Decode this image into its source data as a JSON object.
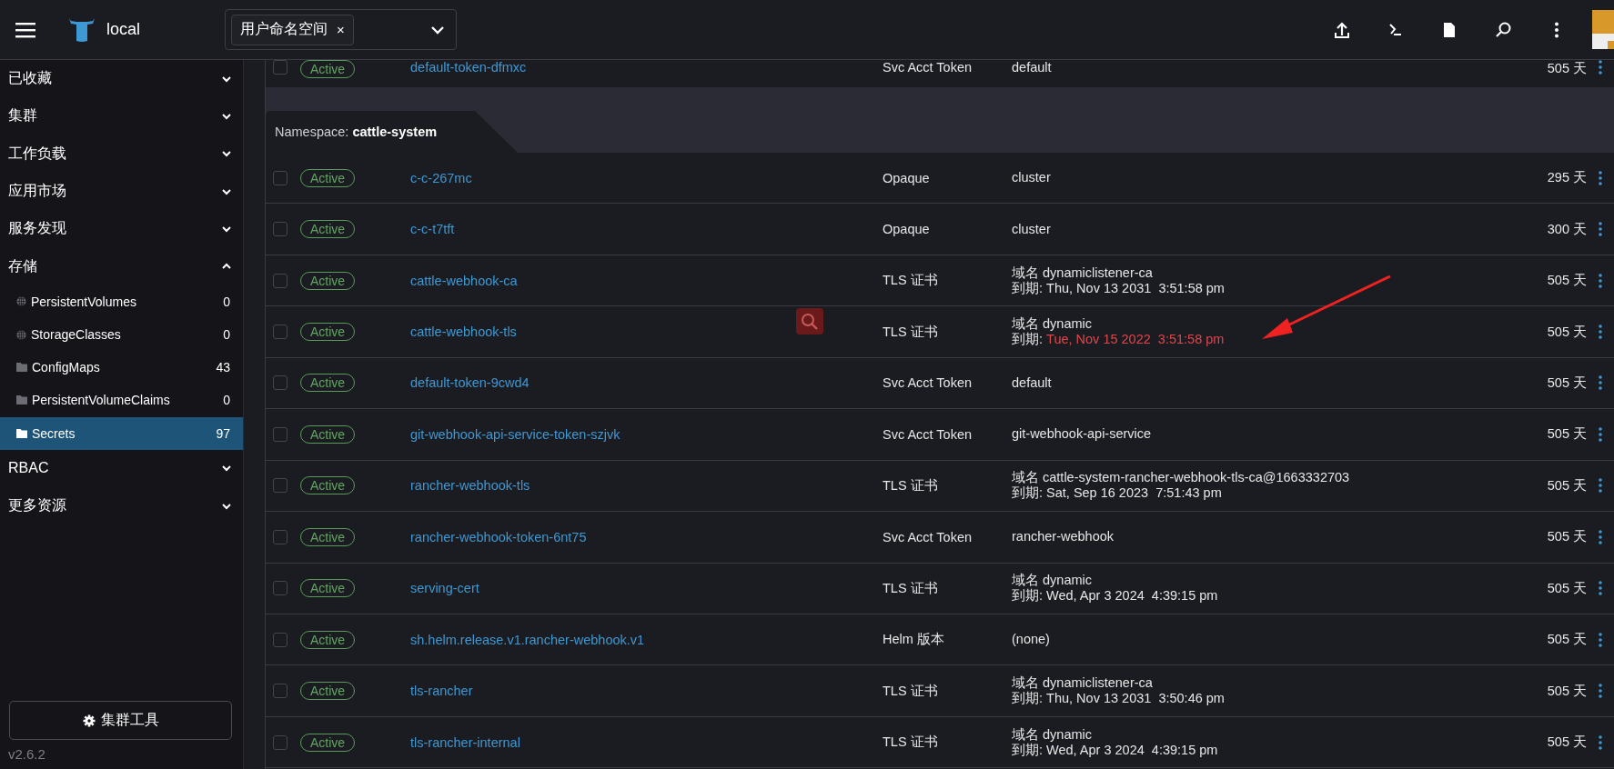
{
  "header": {
    "cluster": "local",
    "namespace_chip": "用户命名空间",
    "chip_remove": "×"
  },
  "sidebar": {
    "groups": [
      {
        "label": "已收藏",
        "expanded": false
      },
      {
        "label": "集群",
        "expanded": false
      },
      {
        "label": "工作负载",
        "expanded": false
      },
      {
        "label": "应用市场",
        "expanded": false
      },
      {
        "label": "服务发现",
        "expanded": false
      },
      {
        "label": "存储",
        "expanded": true,
        "children": [
          {
            "label": "PersistentVolumes",
            "count": "0",
            "kind": "globe",
            "selected": false
          },
          {
            "label": "StorageClasses",
            "count": "0",
            "kind": "globe",
            "selected": false
          },
          {
            "label": "ConfigMaps",
            "count": "43",
            "kind": "folder",
            "selected": false
          },
          {
            "label": "PersistentVolumeClaims",
            "count": "0",
            "kind": "folder",
            "selected": false
          },
          {
            "label": "Secrets",
            "count": "97",
            "kind": "folder",
            "selected": true
          }
        ]
      },
      {
        "label": "RBAC",
        "expanded": false
      },
      {
        "label": "更多资源",
        "expanded": false
      }
    ],
    "tools_button": "集群工具",
    "version": "v2.6.2"
  },
  "table": {
    "items": [
      {
        "kind": "row",
        "checked": false,
        "state": "Active",
        "name": "default-token-dfmxc",
        "type": "Svc Acct Token",
        "data": {
          "kind": "text",
          "text": "default"
        },
        "age": "505 天"
      },
      {
        "kind": "group",
        "label": "Namespace:",
        "value": "cattle-system"
      },
      {
        "kind": "row",
        "checked": false,
        "state": "Active",
        "name": "c-c-267mc",
        "type": "Opaque",
        "data": {
          "kind": "text",
          "text": "cluster"
        },
        "age": "295 天"
      },
      {
        "kind": "row",
        "checked": false,
        "state": "Active",
        "name": "c-c-t7tft",
        "type": "Opaque",
        "data": {
          "kind": "text",
          "text": "cluster"
        },
        "age": "300 天"
      },
      {
        "kind": "row",
        "checked": false,
        "state": "Active",
        "name": "cattle-webhook-ca",
        "type": "TLS 证书",
        "data": {
          "kind": "cert",
          "domain": "域名 dynamiclistener-ca",
          "expiry_label": "到期: ",
          "expiry": "Thu, Nov 13 2031  3:51:58 pm",
          "expired": false
        },
        "age": "505 天"
      },
      {
        "kind": "row",
        "checked": false,
        "state": "Active",
        "name": "cattle-webhook-tls",
        "type": "TLS 证书",
        "data": {
          "kind": "cert",
          "domain": "域名 dynamic",
          "expiry_label": "到期: ",
          "expiry": "Tue, Nov 15 2022  3:51:58 pm",
          "expired": true
        },
        "age": "505 天"
      },
      {
        "kind": "row",
        "checked": false,
        "state": "Active",
        "name": "default-token-9cwd4",
        "type": "Svc Acct Token",
        "data": {
          "kind": "text",
          "text": "default"
        },
        "age": "505 天"
      },
      {
        "kind": "row",
        "checked": false,
        "state": "Active",
        "name": "git-webhook-api-service-token-szjvk",
        "type": "Svc Acct Token",
        "data": {
          "kind": "text",
          "text": "git-webhook-api-service"
        },
        "age": "505 天"
      },
      {
        "kind": "row",
        "checked": false,
        "state": "Active",
        "name": "rancher-webhook-tls",
        "type": "TLS 证书",
        "data": {
          "kind": "cert",
          "domain": "域名 cattle-system-rancher-webhook-tls-ca@1663332703",
          "expiry_label": "到期: ",
          "expiry": "Sat, Sep 16 2023  7:51:43 pm",
          "expired": false
        },
        "age": "505 天"
      },
      {
        "kind": "row",
        "checked": false,
        "state": "Active",
        "name": "rancher-webhook-token-6nt75",
        "type": "Svc Acct Token",
        "data": {
          "kind": "text",
          "text": "rancher-webhook"
        },
        "age": "505 天"
      },
      {
        "kind": "row",
        "checked": false,
        "state": "Active",
        "name": "serving-cert",
        "type": "TLS 证书",
        "data": {
          "kind": "cert",
          "domain": "域名 dynamic",
          "expiry_label": "到期: ",
          "expiry": "Wed, Apr 3 2024  4:39:15 pm",
          "expired": false
        },
        "age": "505 天"
      },
      {
        "kind": "row",
        "checked": false,
        "state": "Active",
        "name": "sh.helm.release.v1.rancher-webhook.v1",
        "type": "Helm 版本",
        "data": {
          "kind": "text",
          "text": "(none)"
        },
        "age": "505 天"
      },
      {
        "kind": "row",
        "checked": false,
        "state": "Active",
        "name": "tls-rancher",
        "type": "TLS 证书",
        "data": {
          "kind": "cert",
          "domain": "域名 dynamiclistener-ca",
          "expiry_label": "到期: ",
          "expiry": "Thu, Nov 13 2031  3:50:46 pm",
          "expired": false
        },
        "age": "505 天"
      },
      {
        "kind": "row",
        "checked": false,
        "state": "Active",
        "name": "tls-rancher-internal",
        "type": "TLS 证书",
        "data": {
          "kind": "cert",
          "domain": "域名 dynamic",
          "expiry_label": "到期: ",
          "expiry": "Wed, Apr 3 2024  4:39:15 pm",
          "expired": false
        },
        "age": "505 天"
      }
    ]
  }
}
